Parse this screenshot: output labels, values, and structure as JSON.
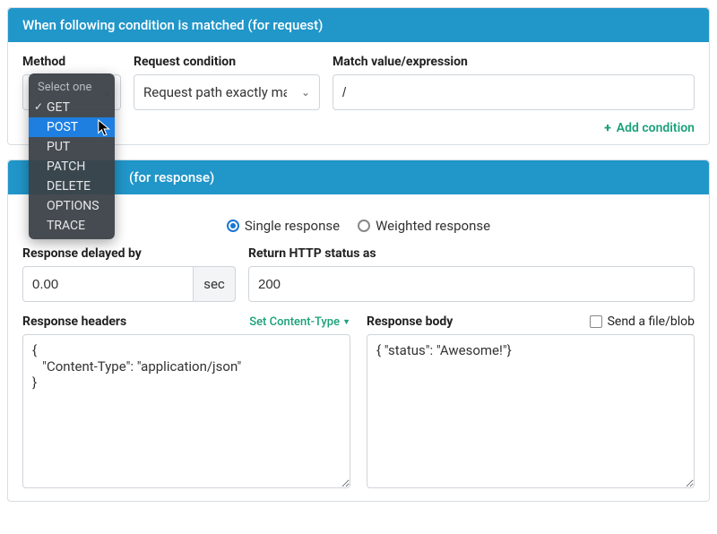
{
  "request_panel": {
    "title": "When following condition is matched (for request)",
    "method_label": "Method",
    "method_placeholder": "Select one",
    "method_options": [
      {
        "value": "GET",
        "checked": true,
        "hovered": false
      },
      {
        "value": "POST",
        "checked": false,
        "hovered": true
      },
      {
        "value": "PUT",
        "checked": false,
        "hovered": false
      },
      {
        "value": "PATCH",
        "checked": false,
        "hovered": false
      },
      {
        "value": "DELETE",
        "checked": false,
        "hovered": false
      },
      {
        "value": "OPTIONS",
        "checked": false,
        "hovered": false
      },
      {
        "value": "TRACE",
        "checked": false,
        "hovered": false
      }
    ],
    "request_condition_label": "Request condition",
    "request_condition_value": "Request path exactly matches",
    "match_value_label": "Match value/expression",
    "match_value": "/",
    "add_condition_label": "Add condition"
  },
  "response_panel": {
    "title_suffix": "(for response)",
    "response_type": {
      "single_label": "Single response",
      "weighted_label": "Weighted response",
      "selected": "single"
    },
    "delay_label": "Response delayed by",
    "delay_value": "0.00",
    "delay_unit": "sec",
    "status_label": "Return HTTP status as",
    "status_value": "200",
    "headers_label": "Response headers",
    "set_content_type_label": "Set Content-Type",
    "headers_value": "{\n   \"Content-Type\": \"application/json\"\n}",
    "body_label": "Response body",
    "send_file_label": "Send a file/blob",
    "send_file_checked": false,
    "body_value": "{ \"status\": \"Awesome!\"}"
  }
}
